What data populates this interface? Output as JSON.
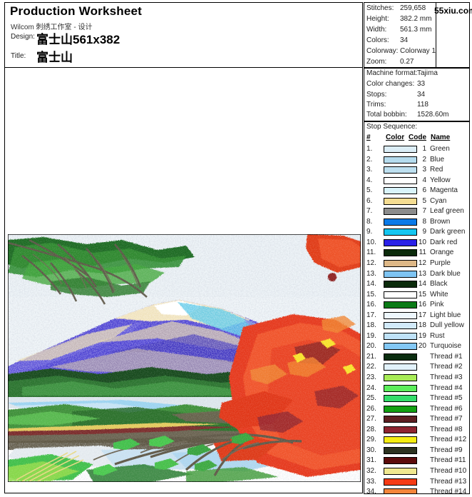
{
  "header": {
    "title": "Production Worksheet",
    "subtitle": "Wilcom 刺绣工作室 - 设计",
    "design_label": "Design:",
    "design_value": "富士山561x382",
    "title_label": "Title:",
    "title_value": "富士山"
  },
  "logo": {
    "text": "55xiu.com"
  },
  "stats": [
    {
      "key": "Stitches:",
      "value": "259,658"
    },
    {
      "key": "Height:",
      "value": "382.2 mm"
    },
    {
      "key": "Width:",
      "value": "561.3 mm"
    },
    {
      "key": "Colors:",
      "value": "34"
    },
    {
      "key": "Colorway:",
      "value": "Colorway 1"
    },
    {
      "key": "Zoom:",
      "value": "0.27"
    }
  ],
  "machine": [
    {
      "key": "Machine format:",
      "value": "Tajima"
    },
    {
      "key": "Color changes:",
      "value": "33"
    },
    {
      "key": "Stops:",
      "value": "34"
    },
    {
      "key": "Trims:",
      "value": "118"
    },
    {
      "key": "Total bobbin:",
      "value": "1528.60m"
    }
  ],
  "stop_sequence": {
    "caption": "Stop Sequence:",
    "columns": [
      "#",
      "Color",
      "Code",
      "Name"
    ],
    "rows": [
      {
        "num": "1.",
        "swatch": "#dceef7",
        "code": "1",
        "name": "Green"
      },
      {
        "num": "2.",
        "swatch": "#b6dcee",
        "code": "2",
        "name": "Blue"
      },
      {
        "num": "3.",
        "swatch": "#bee0f0",
        "code": "3",
        "name": "Red"
      },
      {
        "num": "4.",
        "swatch": "#ffffff",
        "code": "4",
        "name": "Yellow"
      },
      {
        "num": "5.",
        "swatch": "#d9f4fb",
        "code": "6",
        "name": "Magenta"
      },
      {
        "num": "6.",
        "swatch": "#f5dd92",
        "code": "5",
        "name": "Cyan"
      },
      {
        "num": "7.",
        "swatch": "#8c8c8c",
        "code": "7",
        "name": "Leaf green"
      },
      {
        "num": "8.",
        "swatch": "#0a7ae8",
        "code": "8",
        "name": "Brown"
      },
      {
        "num": "9.",
        "swatch": "#14c6f0",
        "code": "9",
        "name": "Dark green"
      },
      {
        "num": "10.",
        "swatch": "#2a20e8",
        "code": "10",
        "name": "Dark red"
      },
      {
        "num": "11.",
        "swatch": "#0b2b0b",
        "code": "11",
        "name": "Orange"
      },
      {
        "num": "12.",
        "swatch": "#deb887",
        "code": "12",
        "name": "Purple"
      },
      {
        "num": "13.",
        "swatch": "#7ec4f2",
        "code": "13",
        "name": "Dark blue"
      },
      {
        "num": "14.",
        "swatch": "#0b2b0b",
        "code": "14",
        "name": "Black"
      },
      {
        "num": "15.",
        "swatch": "#ffffff",
        "code": "15",
        "name": "White"
      },
      {
        "num": "16.",
        "swatch": "#0a7a16",
        "code": "16",
        "name": "Pink"
      },
      {
        "num": "17.",
        "swatch": "#eef7fd",
        "code": "17",
        "name": "Light blue"
      },
      {
        "num": "18.",
        "swatch": "#d2eafa",
        "code": "18",
        "name": "Dull yellow"
      },
      {
        "num": "19.",
        "swatch": "#bfe2f8",
        "code": "19",
        "name": "Rust"
      },
      {
        "num": "20.",
        "swatch": "#83c8f5",
        "code": "20",
        "name": "Turquoise"
      },
      {
        "num": "21.",
        "swatch": "#0b2d10",
        "code": "",
        "name": "Thread #1"
      },
      {
        "num": "22.",
        "swatch": "#e2f2fb",
        "code": "",
        "name": "Thread #2"
      },
      {
        "num": "23.",
        "swatch": "#a8ec56",
        "code": "",
        "name": "Thread #3"
      },
      {
        "num": "24.",
        "swatch": "#5bee5b",
        "code": "",
        "name": "Thread #4"
      },
      {
        "num": "25.",
        "swatch": "#33dd6a",
        "code": "",
        "name": "Thread #5"
      },
      {
        "num": "26.",
        "swatch": "#12a012",
        "code": "",
        "name": "Thread #6"
      },
      {
        "num": "27.",
        "swatch": "#5c1f22",
        "code": "",
        "name": "Thread #7"
      },
      {
        "num": "28.",
        "swatch": "#8e2430",
        "code": "",
        "name": "Thread #8"
      },
      {
        "num": "29.",
        "swatch": "#f5ed14",
        "code": "",
        "name": "Thread #12"
      },
      {
        "num": "30.",
        "swatch": "#2c3220",
        "code": "",
        "name": "Thread #9"
      },
      {
        "num": "31.",
        "swatch": "#5c0b0b",
        "code": "",
        "name": "Thread #11"
      },
      {
        "num": "32.",
        "swatch": "#f0e890",
        "code": "",
        "name": "Thread #10"
      },
      {
        "num": "33.",
        "swatch": "#f53a14",
        "code": "",
        "name": "Thread #13"
      },
      {
        "num": "34.",
        "swatch": "#f5853a",
        "code": "",
        "name": "Thread #14"
      }
    ]
  }
}
